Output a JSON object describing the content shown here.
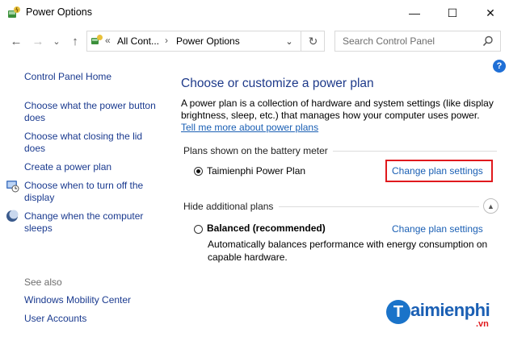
{
  "window": {
    "title": "Power Options",
    "minimize": "—",
    "maximize": "☐",
    "close": "✕"
  },
  "nav": {
    "back": "←",
    "forward": "→",
    "recent": "⌄",
    "up": "↑",
    "breadcrumb_overflow": "«",
    "breadcrumb_1": "All Cont...",
    "breadcrumb_sep": "›",
    "breadcrumb_2": "Power Options",
    "dropdown": "⌄",
    "refresh": "↻"
  },
  "search": {
    "placeholder": "Search Control Panel"
  },
  "help": "?",
  "sidebar": {
    "home": "Control Panel Home",
    "links": [
      "Choose what the power button does",
      "Choose what closing the lid does",
      "Create a power plan",
      "Choose when to turn off the display",
      "Change when the computer sleeps"
    ],
    "see_also_label": "See also",
    "see_also": [
      "Windows Mobility Center",
      "User Accounts"
    ]
  },
  "main": {
    "heading": "Choose or customize a power plan",
    "description": "A power plan is a collection of hardware and system settings (like display brightness, sleep, etc.) that manages how your computer uses power.",
    "description_link": "Tell me more about power plans",
    "battery_section": "Plans shown on the battery meter",
    "plan1_name": "Taimienphi Power Plan",
    "plan1_link": "Change plan settings",
    "hidden_section": "Hide additional plans",
    "plan2_name": "Balanced (recommended)",
    "plan2_link": "Change plan settings",
    "plan2_desc": "Automatically balances performance with energy consumption on capable hardware."
  },
  "watermark": {
    "letter": "T",
    "text": "aimienphi",
    "suffix": ".vn"
  }
}
